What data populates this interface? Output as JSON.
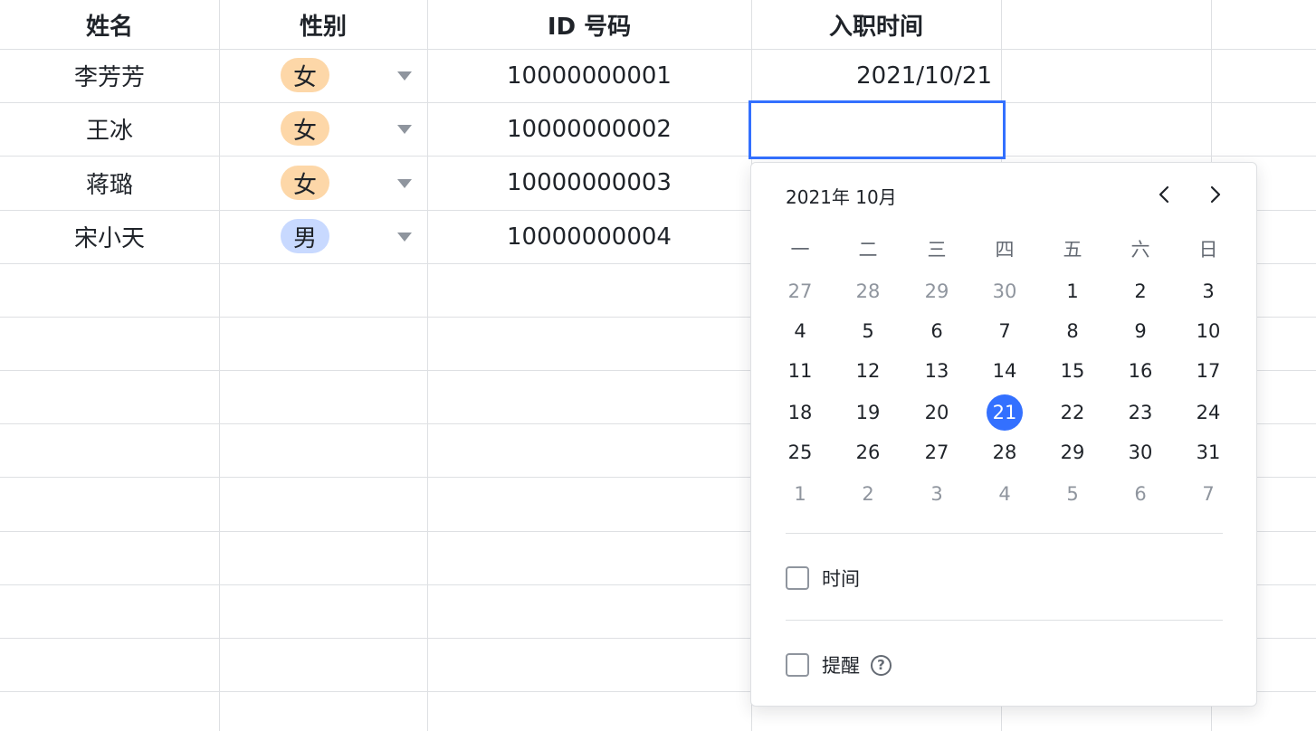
{
  "sheet": {
    "headers": [
      "姓名",
      "性别",
      "ID 号码",
      "入职时间"
    ],
    "rows": [
      {
        "name": "李芳芳",
        "gender": "女",
        "gender_color": "#fdd7a8",
        "id": "10000000001",
        "date": "2021/10/21"
      },
      {
        "name": "王冰",
        "gender": "女",
        "gender_color": "#fdd7a8",
        "id": "10000000002",
        "date": ""
      },
      {
        "name": "蒋璐",
        "gender": "女",
        "gender_color": "#fdd7a8",
        "id": "10000000003",
        "date": ""
      },
      {
        "name": "宋小天",
        "gender": "男",
        "gender_color": "#c8d9ff",
        "id": "10000000004",
        "date": ""
      }
    ]
  },
  "picker": {
    "title": "2021年 10月",
    "prev_icon": "chevron-left-icon",
    "next_icon": "chevron-right-icon",
    "weekdays": [
      "一",
      "二",
      "三",
      "四",
      "五",
      "六",
      "日"
    ],
    "weeks": [
      [
        "27",
        "28",
        "29",
        "30",
        "1",
        "2",
        "3"
      ],
      [
        "4",
        "5",
        "6",
        "7",
        "8",
        "9",
        "10"
      ],
      [
        "11",
        "12",
        "13",
        "14",
        "15",
        "16",
        "17"
      ],
      [
        "18",
        "19",
        "20",
        "21",
        "22",
        "23",
        "24"
      ],
      [
        "25",
        "26",
        "27",
        "28",
        "29",
        "30",
        "31"
      ],
      [
        "1",
        "2",
        "3",
        "4",
        "5",
        "6",
        "7"
      ]
    ],
    "selected_day": "21",
    "accent_color": "#3370ff",
    "time_label": "时间",
    "reminder_label": "提醒",
    "help_glyph": "?"
  }
}
